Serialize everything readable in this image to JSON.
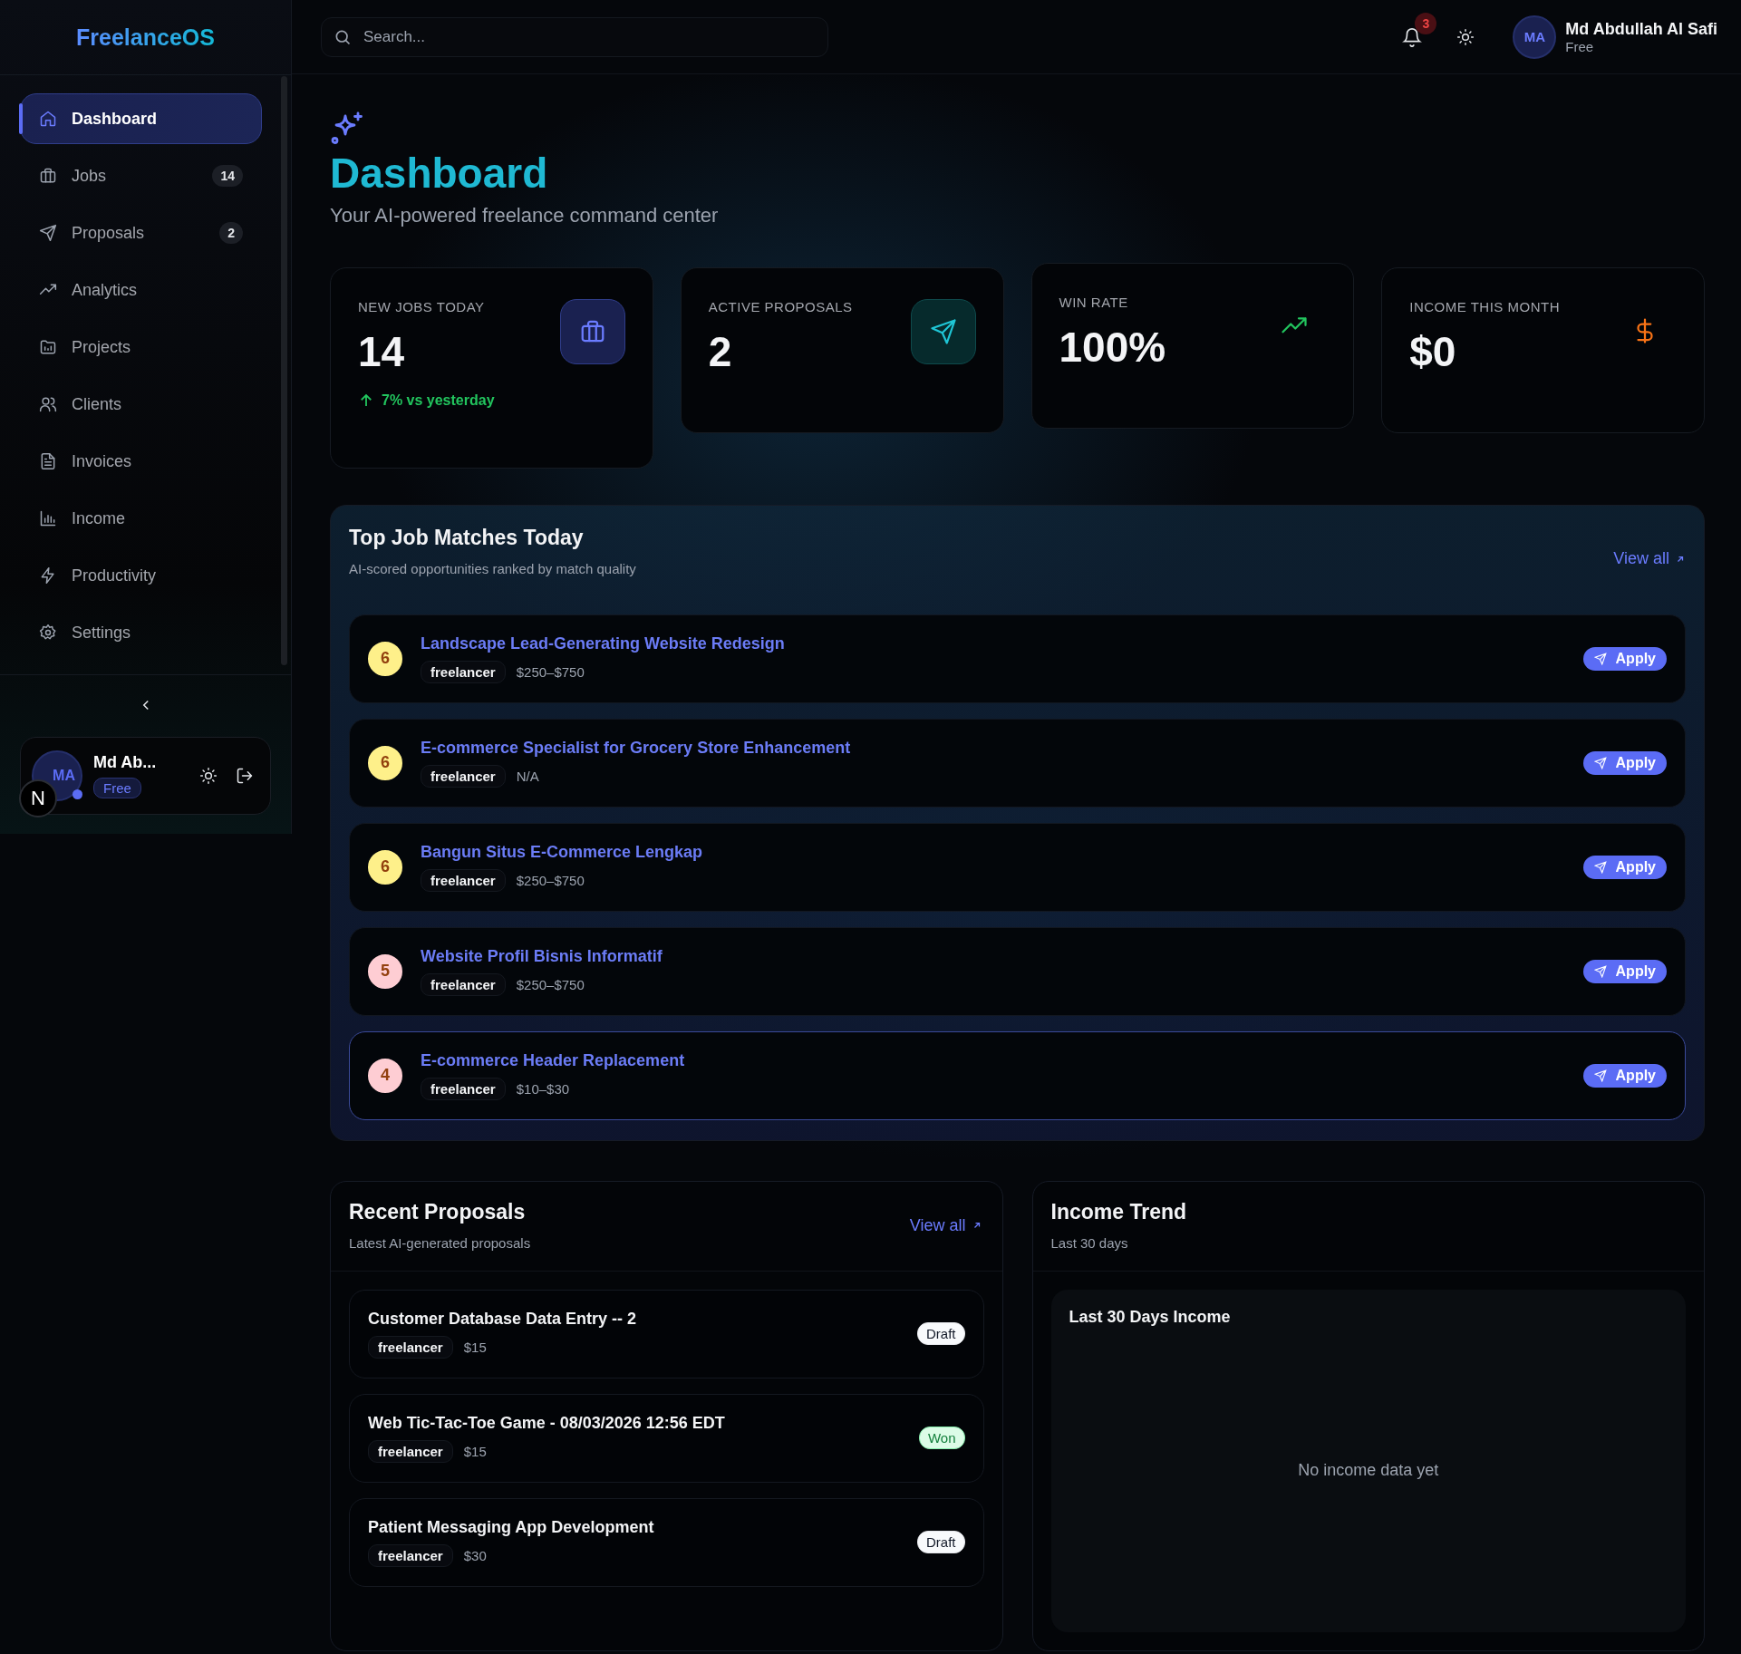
{
  "sidebar": {
    "logo": "FreelanceOS",
    "items": [
      {
        "label": "Dashboard",
        "selected": true
      },
      {
        "label": "Jobs",
        "badge": "14",
        "selected": false
      },
      {
        "label": "Proposals",
        "badge": "2",
        "selected": false
      },
      {
        "label": "Analytics",
        "selected": false
      },
      {
        "label": "Projects",
        "selected": false
      },
      {
        "label": "Clients",
        "selected": false
      },
      {
        "label": "Invoices",
        "selected": false
      },
      {
        "label": "Income",
        "selected": false
      },
      {
        "label": "Productivity",
        "selected": false
      },
      {
        "label": "Settings",
        "selected": false
      }
    ],
    "user": {
      "initials": "MA",
      "name": "Md Ab...",
      "plan": "Free",
      "online": true
    },
    "dev_badge": "N"
  },
  "header": {
    "search": {
      "placeholder": "Search..."
    },
    "notifications": "3",
    "user": {
      "initials": "MA",
      "name": "Md Abdullah Al Safi",
      "plan": "Free"
    }
  },
  "page": {
    "title": "Dashboard",
    "subtitle": "Your AI-powered freelance command center"
  },
  "stats": [
    {
      "label": "NEW JOBS TODAY",
      "value": "14",
      "trend": "7% vs yesterday"
    },
    {
      "label": "ACTIVE PROPOSALS",
      "value": "2"
    },
    {
      "label": "WIN RATE",
      "value": "100%"
    },
    {
      "label": "INCOME THIS MONTH",
      "value": "$0"
    }
  ],
  "job_matches": {
    "title": "Top Job Matches Today",
    "subtitle": "AI-scored opportunities ranked by match quality",
    "view_all": "View all",
    "rows": [
      {
        "score": "6",
        "color": "#fef08a",
        "title": "Landscape Lead-Generating Website Redesign",
        "source": "freelancer",
        "budget": "$250–$750",
        "action": "Apply",
        "selected": false
      },
      {
        "score": "6",
        "color": "#fef08a",
        "title": "E-commerce Specialist for Grocery Store Enhancement",
        "source": "freelancer",
        "budget": "N/A",
        "action": "Apply",
        "selected": false
      },
      {
        "score": "6",
        "color": "#fef08a",
        "title": "Bangun Situs E-Commerce Lengkap",
        "source": "freelancer",
        "budget": "$250–$750",
        "action": "Apply",
        "selected": false
      },
      {
        "score": "5",
        "color": "#fecdd3",
        "title": "Website Profil Bisnis Informatif",
        "source": "freelancer",
        "budget": "$250–$750",
        "action": "Apply",
        "selected": false
      },
      {
        "score": "4",
        "color": "#fecdd3",
        "title": "E-commerce Header Replacement",
        "source": "freelancer",
        "budget": "$10–$30",
        "action": "Apply",
        "selected": true
      }
    ]
  },
  "recent_proposals": {
    "title": "Recent Proposals",
    "subtitle": "Latest AI-generated proposals",
    "view_all": "View all",
    "rows": [
      {
        "title": "Customer Database Data Entry -- 2",
        "source": "freelancer",
        "amount": "$15",
        "status": "Draft",
        "kind": "draft"
      },
      {
        "title": "Web Tic-Tac-Toe Game - 08/03/2026 12:56 EDT",
        "source": "freelancer",
        "amount": "$15",
        "status": "Won",
        "kind": "won"
      },
      {
        "title": "Patient Messaging App Development",
        "source": "freelancer",
        "amount": "$30",
        "status": "Draft",
        "kind": "draft"
      }
    ]
  },
  "income_trend": {
    "title": "Income Trend",
    "subtitle": "Last 30 days",
    "chart_title": "Last 30 Days Income",
    "empty_text": "No income data yet"
  }
}
